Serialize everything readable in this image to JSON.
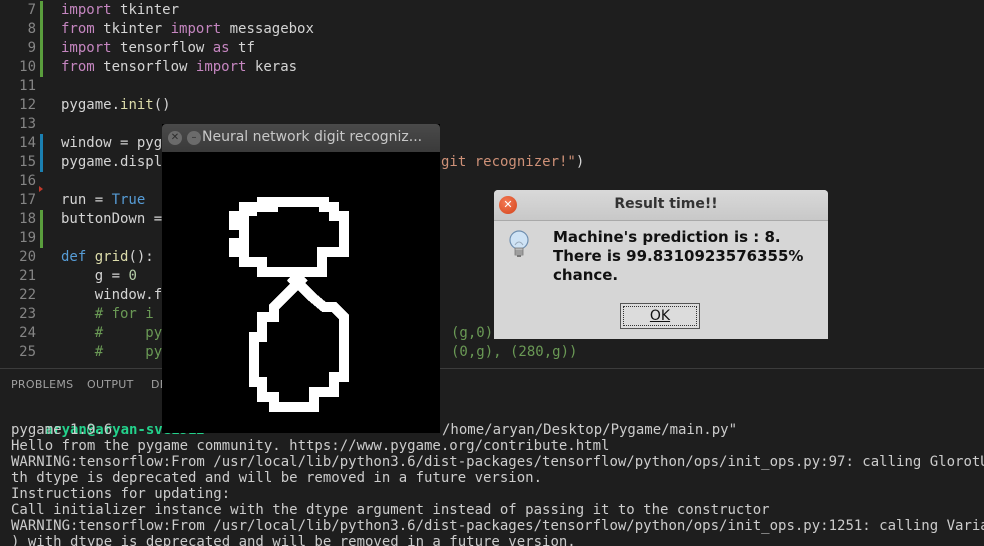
{
  "editor": {
    "lines": [
      {
        "n": "7",
        "mark": "#5a9e3d",
        "parts": [
          [
            "imp",
            "import"
          ],
          [
            "",
            "tkinter"
          ]
        ]
      },
      {
        "n": "8",
        "mark": "#5a9e3d",
        "parts": [
          [
            "imp",
            "from"
          ],
          [
            "",
            "tkinter"
          ],
          [
            "imp",
            "import"
          ],
          [
            "",
            "messagebox"
          ]
        ]
      },
      {
        "n": "9",
        "mark": "#5a9e3d",
        "parts": [
          [
            "imp",
            "import"
          ],
          [
            "",
            "tensorflow"
          ],
          [
            "imp",
            "as"
          ],
          [
            "",
            "tf"
          ]
        ]
      },
      {
        "n": "10",
        "mark": "#5a9e3d",
        "parts": [
          [
            "imp",
            "from"
          ],
          [
            "",
            "tensorflow"
          ],
          [
            "imp",
            "import"
          ],
          [
            "",
            "keras"
          ]
        ]
      },
      {
        "n": "11",
        "mark": "",
        "parts": []
      },
      {
        "n": "12",
        "mark": "",
        "parts": [
          [
            "",
            "pygame."
          ],
          [
            "fn",
            "init"
          ],
          [
            "",
            "()"
          ]
        ]
      },
      {
        "n": "13",
        "mark": "",
        "parts": []
      },
      {
        "n": "14",
        "mark": "#1b80b2",
        "parts": [
          [
            "",
            "window = pyg"
          ]
        ]
      },
      {
        "n": "15",
        "mark": "#1b80b2",
        "parts": [
          [
            "",
            "pygame.displ"
          ]
        ],
        "tail": "git recognizer!\")"
      },
      {
        "n": "16",
        "mark": "",
        "parts": []
      },
      {
        "n": "17",
        "mark": "",
        "parts": [
          [
            "",
            "run = "
          ],
          [
            "true",
            "True"
          ]
        ]
      },
      {
        "n": "18",
        "mark": "#5a9e3d",
        "parts": [
          [
            "",
            "buttonDown ="
          ]
        ]
      },
      {
        "n": "19",
        "mark": "#5a9e3d",
        "parts": []
      },
      {
        "n": "20",
        "mark": "",
        "parts": [
          [
            "def",
            "def"
          ],
          [
            "fn",
            " grid"
          ],
          [
            "",
            "():"
          ]
        ]
      },
      {
        "n": "21",
        "mark": "",
        "parts": [
          [
            "",
            "    g = "
          ],
          [
            "num",
            "0"
          ]
        ]
      },
      {
        "n": "22",
        "mark": "",
        "parts": [
          [
            "",
            "    window.f"
          ]
        ]
      },
      {
        "n": "23",
        "mark": "",
        "parts": [
          [
            "com",
            "    # for i"
          ]
        ]
      },
      {
        "n": "24",
        "mark": "",
        "parts": [
          [
            "com",
            "    #     py"
          ]
        ],
        "tail": "(g,0)"
      },
      {
        "n": "25",
        "mark": "",
        "parts": [
          [
            "com",
            "    #     py"
          ]
        ],
        "tail": "(0,g), (280,g))"
      }
    ]
  },
  "panel": {
    "tabs": [
      "PROBLEMS",
      "OUTPUT",
      "DE"
    ],
    "prompt_user": "aryan@aryan-sve1512",
    "prompt_tail": "/home/aryan/Desktop/Pygame/main.py\"",
    "lines": [
      "pygame 1.9.6",
      "Hello from the pygame community. https://www.pygame.org/contribute.html",
      "WARNING:tensorflow:From /usr/local/lib/python3.6/dist-packages/tensorflow/python/ops/init_ops.py:97: calling GlorotUniform",
      "th dtype is deprecated and will be removed in a future version.",
      "Instructions for updating:",
      "Call initializer instance with the dtype argument instead of passing it to the constructor",
      "WARNING:tensorflow:From /usr/local/lib/python3.6/dist-packages/tensorflow/python/ops/init_ops.py:1251: calling VarianceSca",
      ") with dtype is deprecated and will be removed in a future version."
    ]
  },
  "pygame_window": {
    "title": "Neural network digit recogniz..."
  },
  "dialog": {
    "title": "Result time!!",
    "message_lines": [
      "Machine's prediction is : 8.",
      "There is 99.8310923576355%",
      "chance."
    ],
    "ok_label": "OK",
    "close_icon": "close-icon",
    "info_icon": "lightbulb-icon",
    "accent": "#e0501f"
  }
}
